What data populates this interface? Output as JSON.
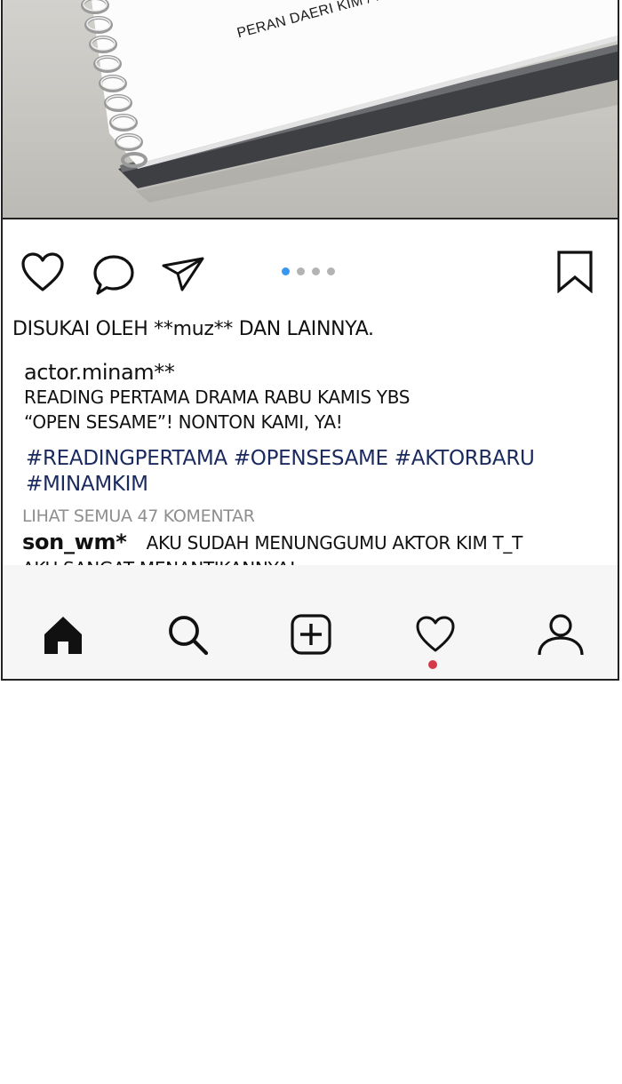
{
  "photo": {
    "script_label": "PERAN DAERI KIM / MINAM KIM"
  },
  "actions": {
    "like_icon": "heart-outline-icon",
    "comment_icon": "speech-bubble-icon",
    "share_icon": "paper-plane-icon",
    "save_icon": "bookmark-icon",
    "carousel_total": 4,
    "carousel_active": 1,
    "active_dot_color": "#3897f0"
  },
  "post": {
    "likes_text": "DISUKAI OLEH **muz** DAN LAINNYA.",
    "username": "actor.minam**",
    "caption_lines": [
      "READING PERTAMA DRAMA RABU KAMIS YBS",
      "“OPEN SESAME”! NONTON KAMI, YA!"
    ],
    "hashtag_lines": [
      "#READINGPERTAMA #OPENSESAME #AKTORBARU",
      "#MINAMKIM"
    ],
    "hashtag_color": "#1b2a5e",
    "view_all_comments": "LIHAT SEMUA 47 KOMENTAR",
    "comment": {
      "user": "son_wm*",
      "text_line1": "AKU SUDAH MENUNGGUMU AKTOR KIM T_T",
      "text_line2": "AKU SANGAT MENANTIKANNYA!"
    }
  },
  "navbar": {
    "items": [
      "home-icon",
      "search-icon",
      "add-post-icon",
      "activity-heart-icon",
      "profile-icon"
    ],
    "notification_color": "#d63a4a"
  }
}
